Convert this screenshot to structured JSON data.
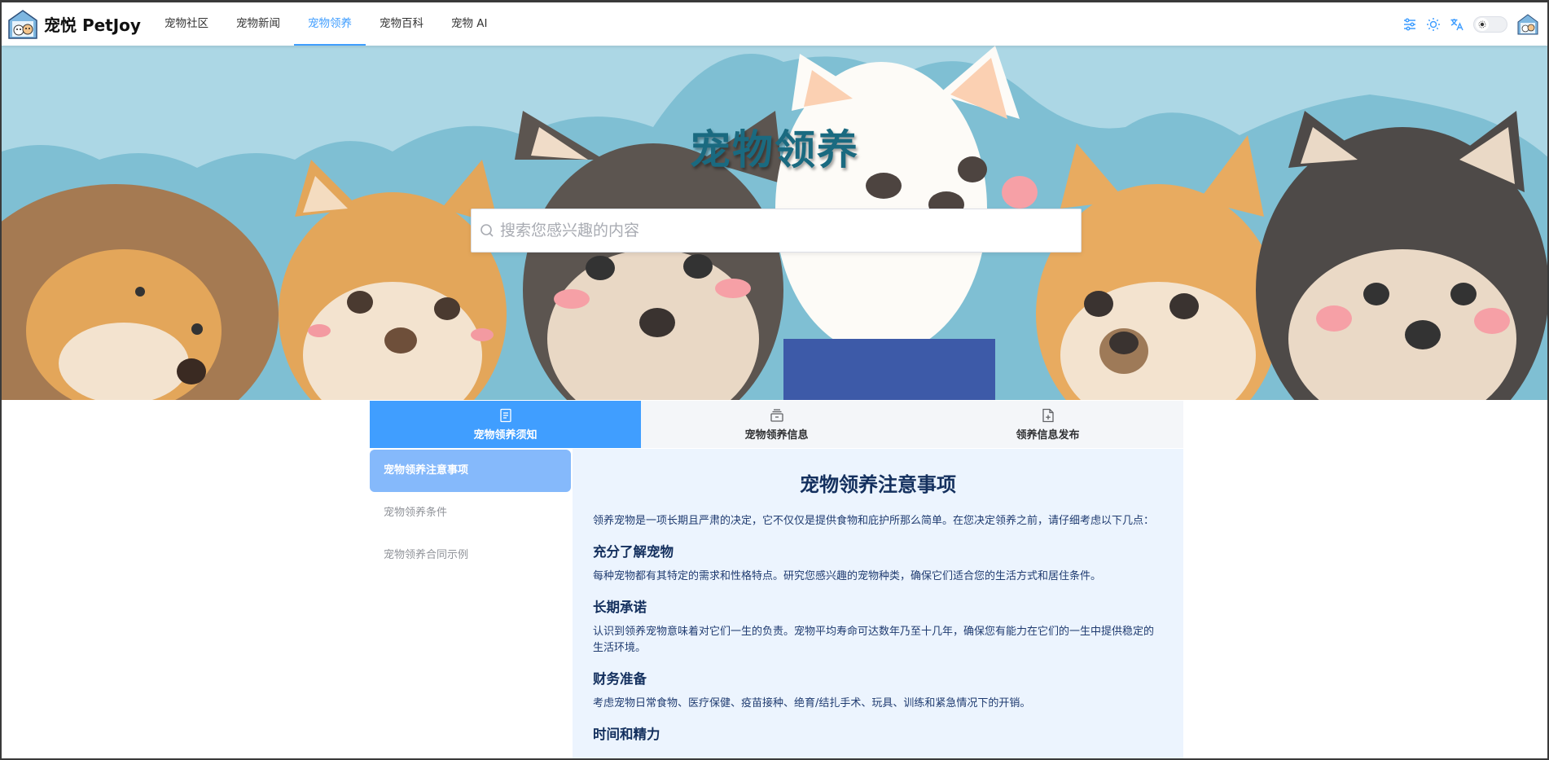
{
  "header": {
    "brand": "宠悦 PetJoy",
    "nav": [
      "宠物社区",
      "宠物新闻",
      "宠物领养",
      "宠物百科",
      "宠物 AI"
    ],
    "active_nav": 2
  },
  "hero": {
    "title": "宠物领养",
    "search_placeholder": "搜索您感兴趣的内容"
  },
  "tabs": [
    {
      "label": "宠物领养须知",
      "icon": "document-icon",
      "active": true
    },
    {
      "label": "宠物领养信息",
      "icon": "box-icon",
      "active": false
    },
    {
      "label": "领养信息发布",
      "icon": "file-add-icon",
      "active": false
    }
  ],
  "sidebar": {
    "items": [
      "宠物领养注意事项",
      "宠物领养条件",
      "宠物领养合同示例"
    ]
  },
  "article": {
    "title": "宠物领养注意事项",
    "intro": "领养宠物是一项长期且严肃的决定，它不仅仅是提供食物和庇护所那么简单。在您决定领养之前，请仔细考虑以下几点：",
    "sections": [
      {
        "heading": "充分了解宠物",
        "body": "每种宠物都有其特定的需求和性格特点。研究您感兴趣的宠物种类，确保它们适合您的生活方式和居住条件。"
      },
      {
        "heading": "长期承诺",
        "body": "认识到领养宠物意味着对它们一生的负责。宠物平均寿命可达数年乃至十几年，确保您有能力在它们的一生中提供稳定的生活环境。"
      },
      {
        "heading": "财务准备",
        "body": "考虑宠物日常食物、医疗保健、疫苗接种、绝育/结扎手术、玩具、训练和紧急情况下的开销。"
      },
      {
        "heading": "时间和精力",
        "body": ""
      }
    ]
  },
  "colors": {
    "accent": "#409eff",
    "hero_bg": "#acd7e5",
    "content_bg": "#ecf4fe",
    "title_dark": "#14305e"
  }
}
